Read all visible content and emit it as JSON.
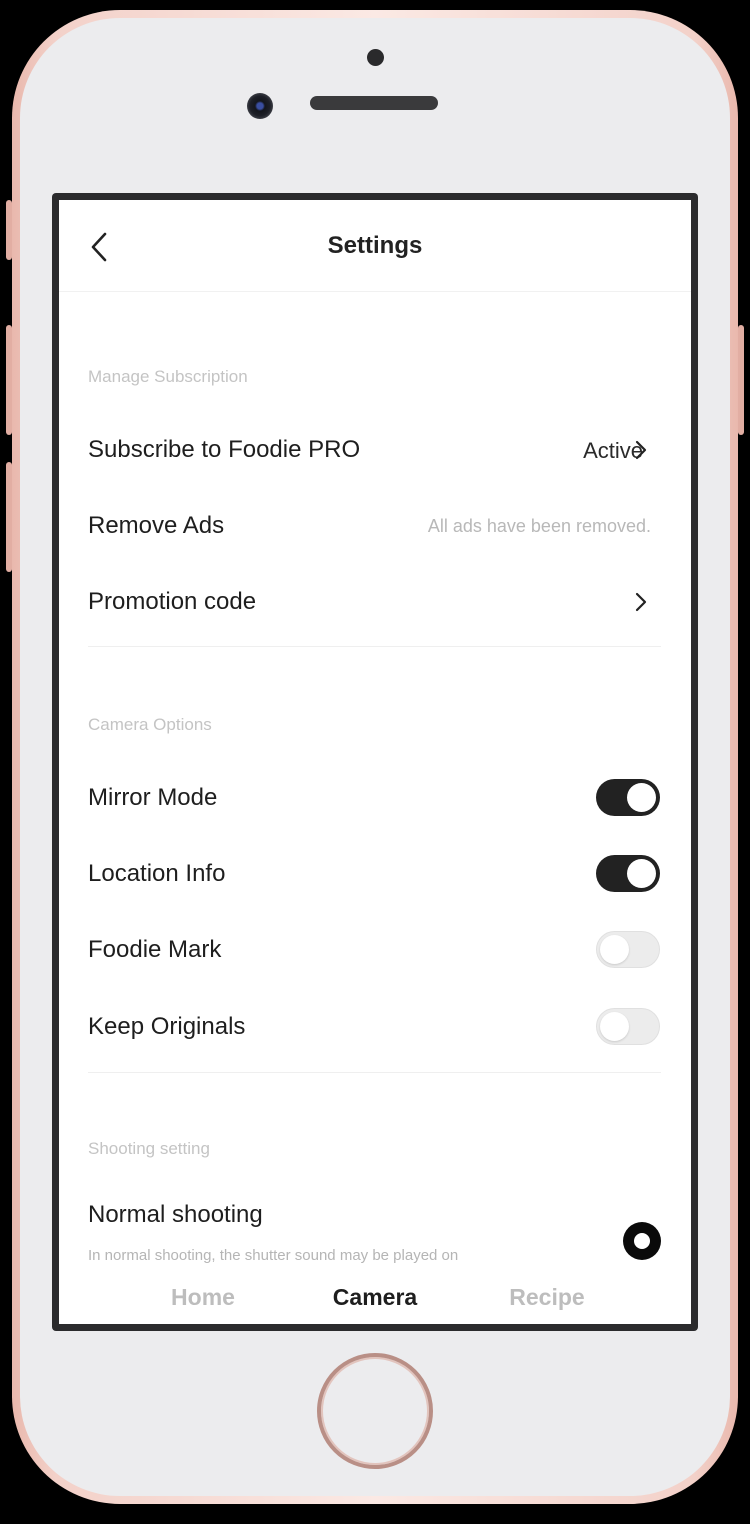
{
  "nav": {
    "title": "Settings",
    "back_icon": "chevron-left-icon"
  },
  "subscription": {
    "section_label": "Manage Subscription",
    "pro_label": "Subscribe to Foodie PRO",
    "pro_status": "Active",
    "remove_ads_label": "Remove Ads",
    "remove_ads_note": "All ads have been removed.",
    "promo_label": "Promotion code"
  },
  "camera": {
    "section_label": "Camera Options",
    "toggles": [
      {
        "label": "Mirror Mode",
        "on": true
      },
      {
        "label": "Location Info",
        "on": true
      },
      {
        "label": "Foodie Mark",
        "on": false
      },
      {
        "label": "Keep Originals",
        "on": false
      }
    ]
  },
  "shooting": {
    "section_label": "Shooting setting",
    "normal_label": "Normal shooting",
    "normal_note": "In normal shooting, the shutter sound may be played on",
    "normal_selected": true
  },
  "tabs": [
    {
      "label": "Home",
      "active": false
    },
    {
      "label": "Camera",
      "active": true
    },
    {
      "label": "Recipe",
      "active": false
    }
  ],
  "colors": {
    "toggle_on": "#222222",
    "toggle_off": "#ececec",
    "accent": "#1e1e1e",
    "muted": "#bdbdbd"
  }
}
